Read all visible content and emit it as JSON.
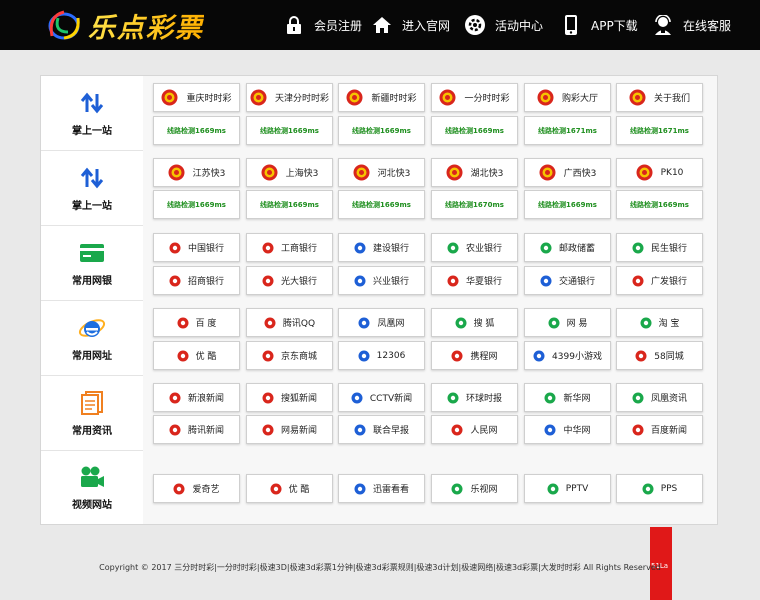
{
  "header": {
    "logo_text": "乐点彩票",
    "nav": [
      {
        "label": "会员注册",
        "icon": "lock-icon"
      },
      {
        "label": "进入官网",
        "icon": "home-icon"
      },
      {
        "label": "活动中心",
        "icon": "gear-icon"
      },
      {
        "label": "APP下载",
        "icon": "phone-icon"
      },
      {
        "label": "在线客服",
        "icon": "support-agent-icon"
      }
    ]
  },
  "sidebar": [
    {
      "label": "掌上一站",
      "icon": "swap-arrows-icon"
    },
    {
      "label": "掌上一站",
      "icon": "swap-arrows-icon"
    },
    {
      "label": "常用网银",
      "icon": "bank-card-icon"
    },
    {
      "label": "常用网址",
      "icon": "ie-browser-icon"
    },
    {
      "label": "常用资讯",
      "icon": "news-document-icon"
    },
    {
      "label": "视频网站",
      "icon": "video-camera-icon"
    }
  ],
  "lottery": {
    "row1": [
      "重庆时时彩",
      "天津分时时彩",
      "新疆时时彩",
      "一分时时彩",
      "购彩大厅",
      "关于我们"
    ],
    "row1_lines": [
      "线路检测1669ms",
      "线路检测1669ms",
      "线路检测1669ms",
      "线路检测1669ms",
      "线路检测1671ms",
      "线路检测1671ms"
    ],
    "row2": [
      "江苏快3",
      "上海快3",
      "河北快3",
      "湖北快3",
      "广西快3",
      "PK10"
    ],
    "row2_lines": [
      "线路检测1669ms",
      "线路检测1669ms",
      "线路检测1669ms",
      "线路检测1670ms",
      "线路检测1669ms",
      "线路检测1669ms"
    ]
  },
  "banks": {
    "row1": [
      "中国银行",
      "工商银行",
      "建设银行",
      "农业银行",
      "邮政储蓄",
      "民生银行"
    ],
    "row2": [
      "招商银行",
      "光大银行",
      "兴业银行",
      "华夏银行",
      "交通银行",
      "广发银行"
    ]
  },
  "sites": {
    "row1": [
      "百 度",
      "腾讯QQ",
      "凤凰网",
      "搜 狐",
      "网 易",
      "淘 宝"
    ],
    "row2": [
      "优 酷",
      "京东商城",
      "12306",
      "携程网",
      "4399小游戏",
      "58同城"
    ]
  },
  "news": {
    "row1": [
      "新浪新闻",
      "搜狐新闻",
      "CCTV新闻",
      "环球时报",
      "新华网",
      "凤凰资讯"
    ],
    "row2": [
      "腾讯新闻",
      "网易新闻",
      "联合早报",
      "人民网",
      "中华网",
      "百度新闻"
    ]
  },
  "video": {
    "row1": [
      "爱奇艺",
      "优 酷",
      "迅雷看看",
      "乐视网",
      "PPTV",
      "PPS"
    ]
  },
  "footer": {
    "text": "Copyright © 2017 三分时时彩|一分时时彩|极速3D|极速3d彩票1分钟|极速3d彩票规则|极速3d计划|极速网络|极速3d彩票|大发时时彩 All Rights Reserved",
    "badge": "51La"
  },
  "colors": {
    "topbar": "#070707",
    "accent_blue": "#1e5fd6",
    "line_green": "#1f8f1f",
    "lottery_red": "#d9261c",
    "footer_red": "#e01818"
  }
}
